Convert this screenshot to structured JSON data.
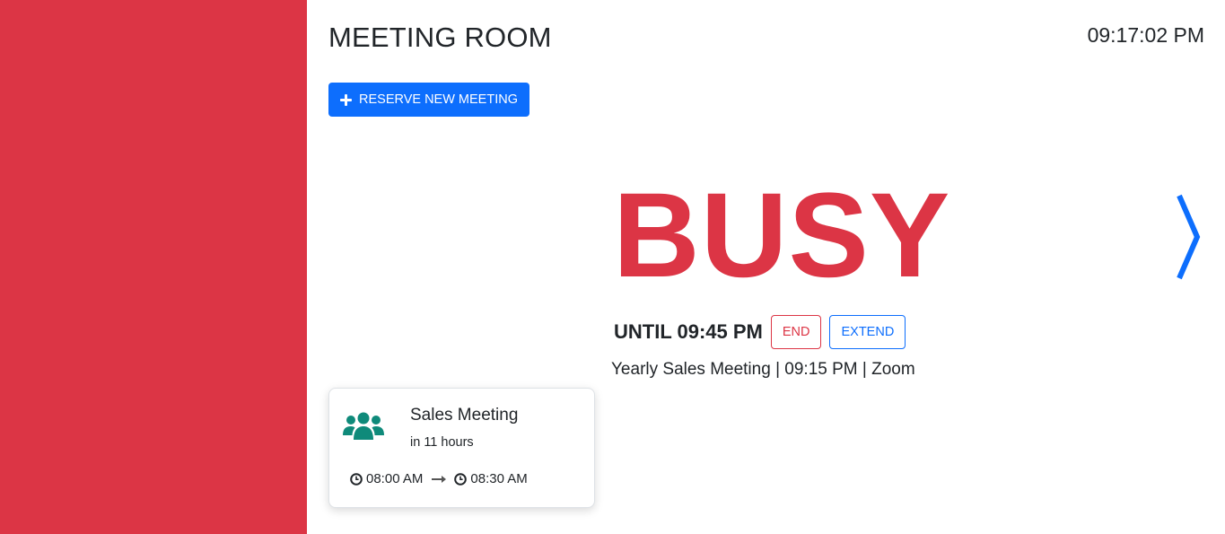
{
  "header": {
    "room_name": "MEETING ROOM",
    "clock": "09:17:02 PM"
  },
  "actions": {
    "reserve_label": "RESERVE NEW MEETING"
  },
  "status": {
    "label": "BUSY",
    "until": "UNTIL 09:45 PM",
    "end_label": "END",
    "extend_label": "EXTEND",
    "meeting_info": "Yearly Sales Meeting | 09:15 PM | Zoom"
  },
  "upcoming": {
    "title": "Sales Meeting",
    "relative": "in 11 hours",
    "start": "08:00 AM",
    "end": "08:30 AM"
  },
  "colors": {
    "busy": "#dc3545",
    "primary": "#0d6efd",
    "icon_teal": "#0f8a7a"
  },
  "icons": [
    "plus-icon",
    "chevron-right-icon",
    "users-group-icon",
    "clock-icon",
    "arrow-right-icon"
  ]
}
